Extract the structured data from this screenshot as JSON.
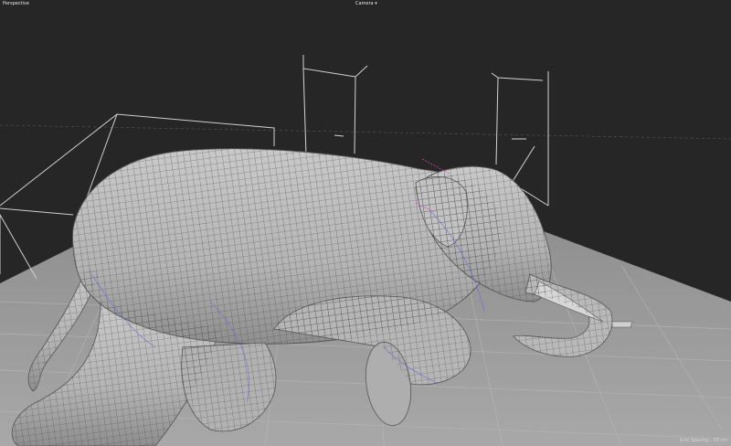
{
  "viewport": {
    "view_mode": "Perspective",
    "camera_menu": "Camera",
    "grid_spacing": "Grid Spacing : 50 cm"
  },
  "colors": {
    "background": "#262626",
    "floor": "#a0a0a0",
    "grid_lines": "#8d8d8d",
    "mesh_surface": "#b9b9b9",
    "wireframe": "#3a3a3a",
    "light_gizmo": "#d0d0d0",
    "selection_magenta": "#e040c0",
    "selection_blue": "#6a6ad8"
  },
  "icons": {
    "camera_menu_arrow": "chevron-down-icon"
  }
}
